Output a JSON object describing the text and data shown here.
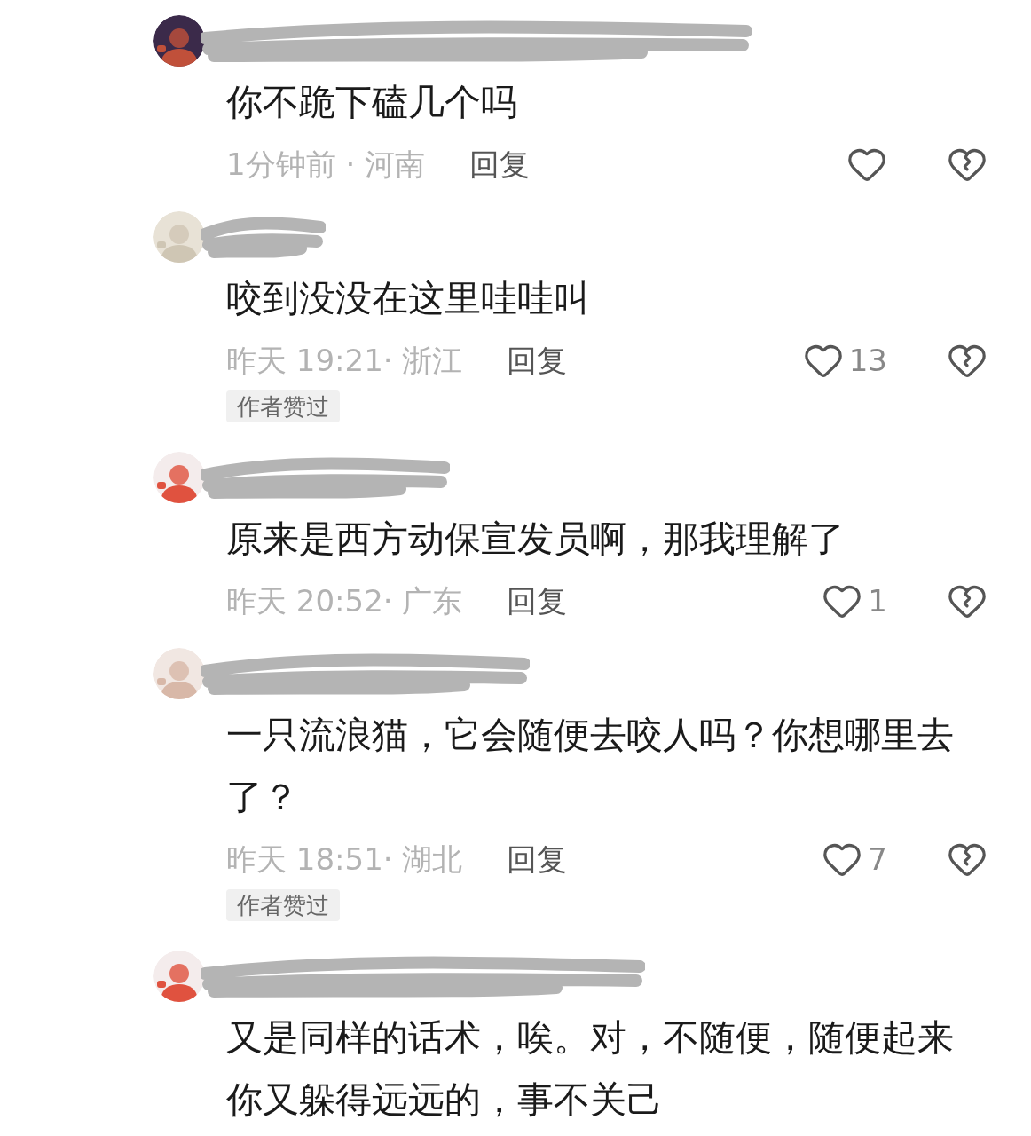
{
  "comments": [
    {
      "text": "你不跪下磕几个吗",
      "time_location": "1分钟前 · 河南",
      "reply": "回复"
    },
    {
      "text": "咬到没没在这里哇哇叫",
      "time_location": "昨天 19:21· 浙江",
      "reply": "回复",
      "likes": "13",
      "badge": "作者赞过"
    },
    {
      "text": "原来是西方动保宣发员啊，那我理解了",
      "time_location": "昨天 20:52· 广东",
      "reply": "回复",
      "likes": "1"
    },
    {
      "text": "一只流浪猫，它会随便去咬人吗？你想哪里去了？",
      "time_location": "昨天 18:51· 湖北",
      "reply": "回复",
      "likes": "7",
      "badge": "作者赞过"
    },
    {
      "text": "又是同样的话术，唉。对，不随便，随便起来你又躲得远远的，事不关己"
    }
  ]
}
